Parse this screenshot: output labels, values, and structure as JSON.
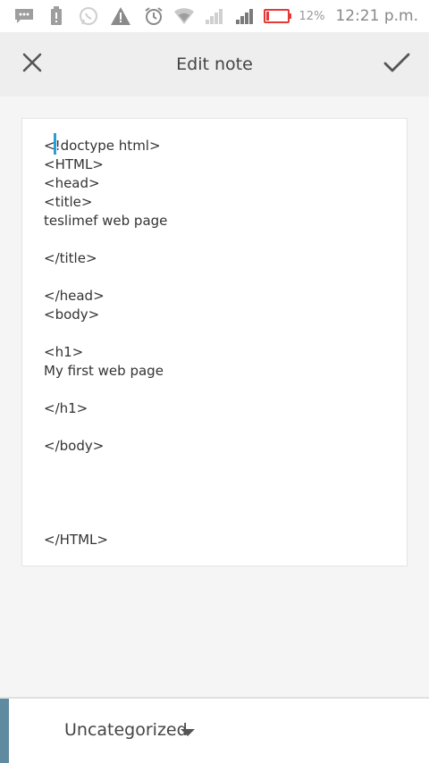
{
  "status_bar": {
    "battery_percent": "12%",
    "time": "12:21 p.m.",
    "icons": [
      "message-icon",
      "battery-saver-icon",
      "whatsapp-icon",
      "warning-icon",
      "alarm-icon",
      "wifi-icon",
      "signal-weak-icon",
      "signal-icon",
      "battery-icon"
    ],
    "battery_color": "#e53935"
  },
  "action_bar": {
    "title": "Edit note",
    "close_icon": "close-icon",
    "confirm_icon": "check-icon"
  },
  "note": {
    "content": "<!doctype html>\n<HTML>\n<head>\n<title>\nteslimef web page\n\n</title>\n\n</head>\n<body>\n\n<h1>\nMy first web page\n\n</h1>\n\n</body>\n\n\n\n\n</HTML>",
    "caret_color": "#2a9fd6"
  },
  "bottom_bar": {
    "category": "Uncategorized",
    "accent_color": "#5f8aa0"
  }
}
